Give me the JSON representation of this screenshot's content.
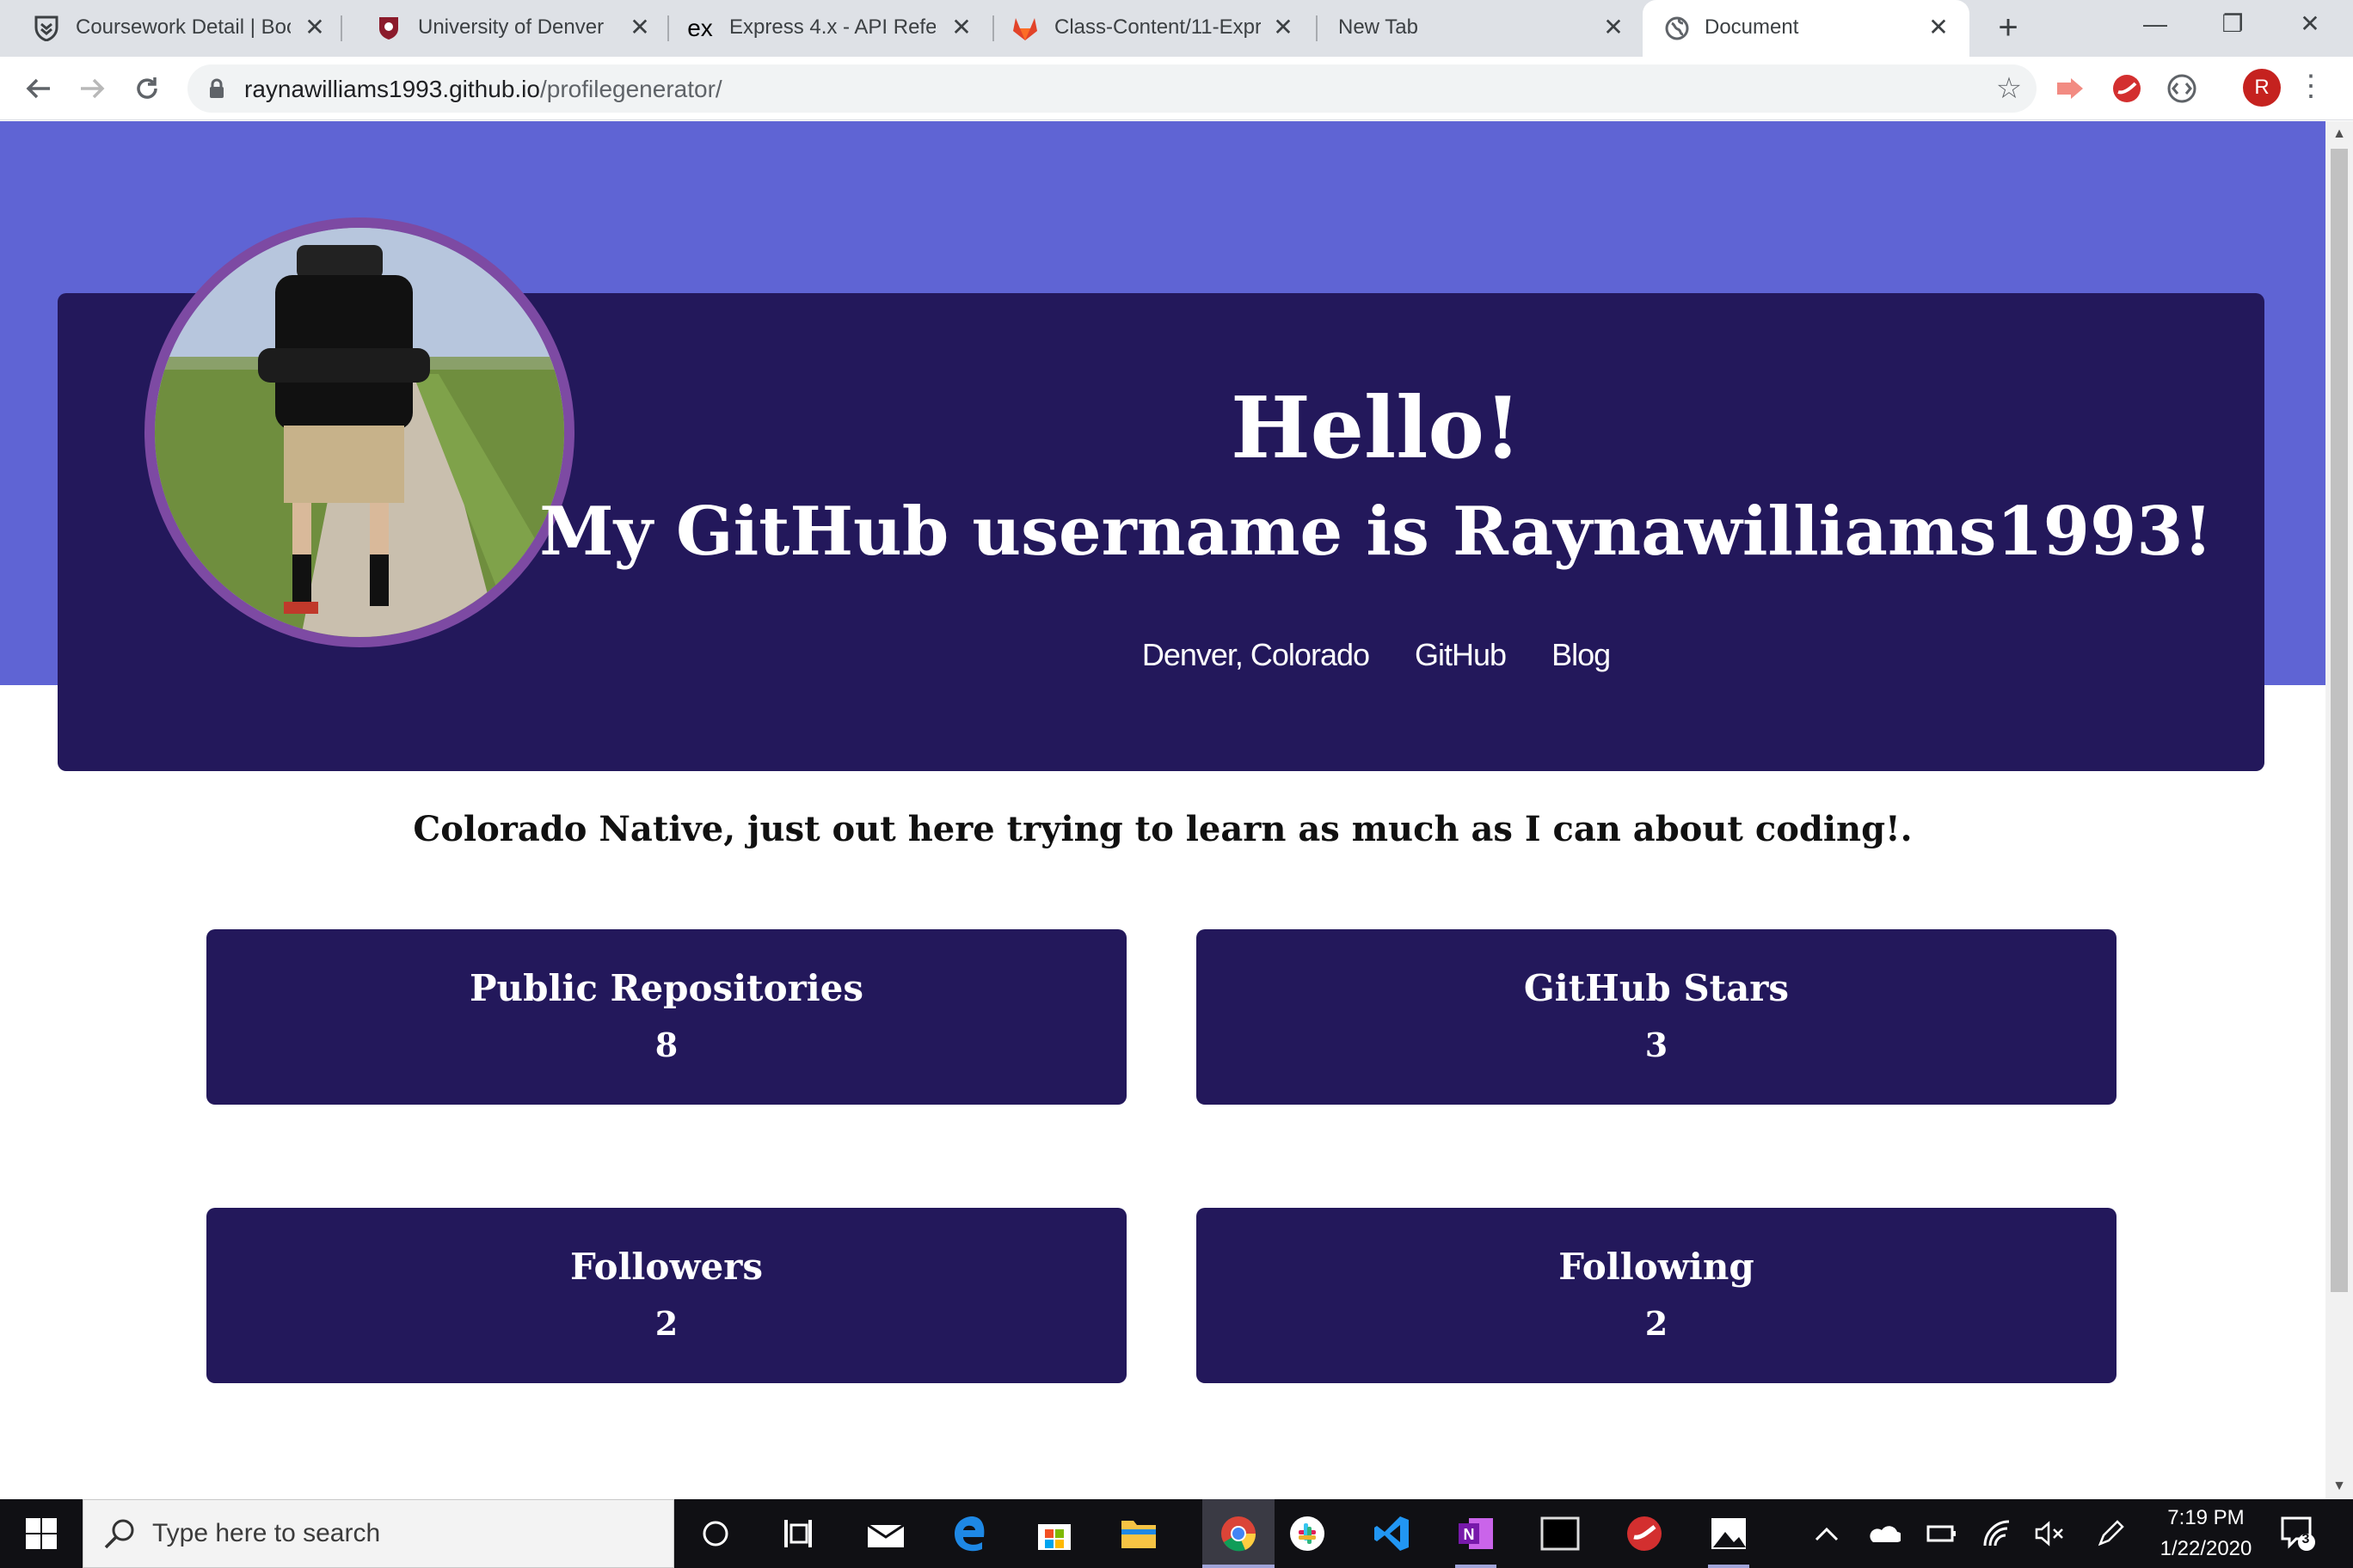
{
  "browser": {
    "tabs": [
      {
        "title": "Coursework Detail | Boo",
        "icon": "bootcamp-shield-icon"
      },
      {
        "title": "University of Denver",
        "icon": "du-crest-icon"
      },
      {
        "title": "Express 4.x - API Refere",
        "icon": "express-ex-icon",
        "icon_text": "ex"
      },
      {
        "title": "Class-Content/11-Expre",
        "icon": "gitlab-fox-icon"
      },
      {
        "title": "New Tab",
        "icon": "none"
      },
      {
        "title": "Document",
        "icon": "globe-icon",
        "active": true
      }
    ],
    "new_tab_symbol": "+",
    "close_symbol": "✕",
    "window_controls": {
      "minimize": "—",
      "restore": "❐",
      "close": "✕"
    },
    "url_host": "raynawilliams1993.github.io",
    "url_path": "/profilegenerator/",
    "avatar_letter": "R"
  },
  "page": {
    "title": "Hello!",
    "subtitle": "My GitHub username is Raynawilliams1993!",
    "links": [
      "Denver, Colorado",
      "GitHub",
      "Blog"
    ],
    "bio": "Colorado Native, just out here trying to learn as much as I can about coding!.",
    "stats": [
      {
        "label": "Public Repositories",
        "value": "8"
      },
      {
        "label": "GitHub Stars",
        "value": "3"
      },
      {
        "label": "Followers",
        "value": "2"
      },
      {
        "label": "Following",
        "value": "2"
      }
    ],
    "colors": {
      "band": "#5f64d4",
      "card": "#23185b",
      "photo_ring": "#7d4aa3"
    }
  },
  "taskbar": {
    "search_placeholder": "Type here to search",
    "time": "7:19 PM",
    "date": "1/22/2020",
    "notification_count": "3"
  }
}
